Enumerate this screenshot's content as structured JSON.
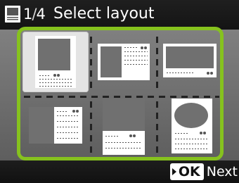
{
  "header": {
    "icon": "layout-icon",
    "page_current": "1",
    "page_total": "4",
    "page_slash": "/",
    "title": "Select layout"
  },
  "layouts": {
    "selected_index": 0,
    "count": 6
  },
  "footer": {
    "ok_label": "OK",
    "next_label": "Next"
  },
  "colors": {
    "selection": "#86c21e",
    "header_bg": "#1a1a1a",
    "content_bg": "#6e6e6e"
  }
}
